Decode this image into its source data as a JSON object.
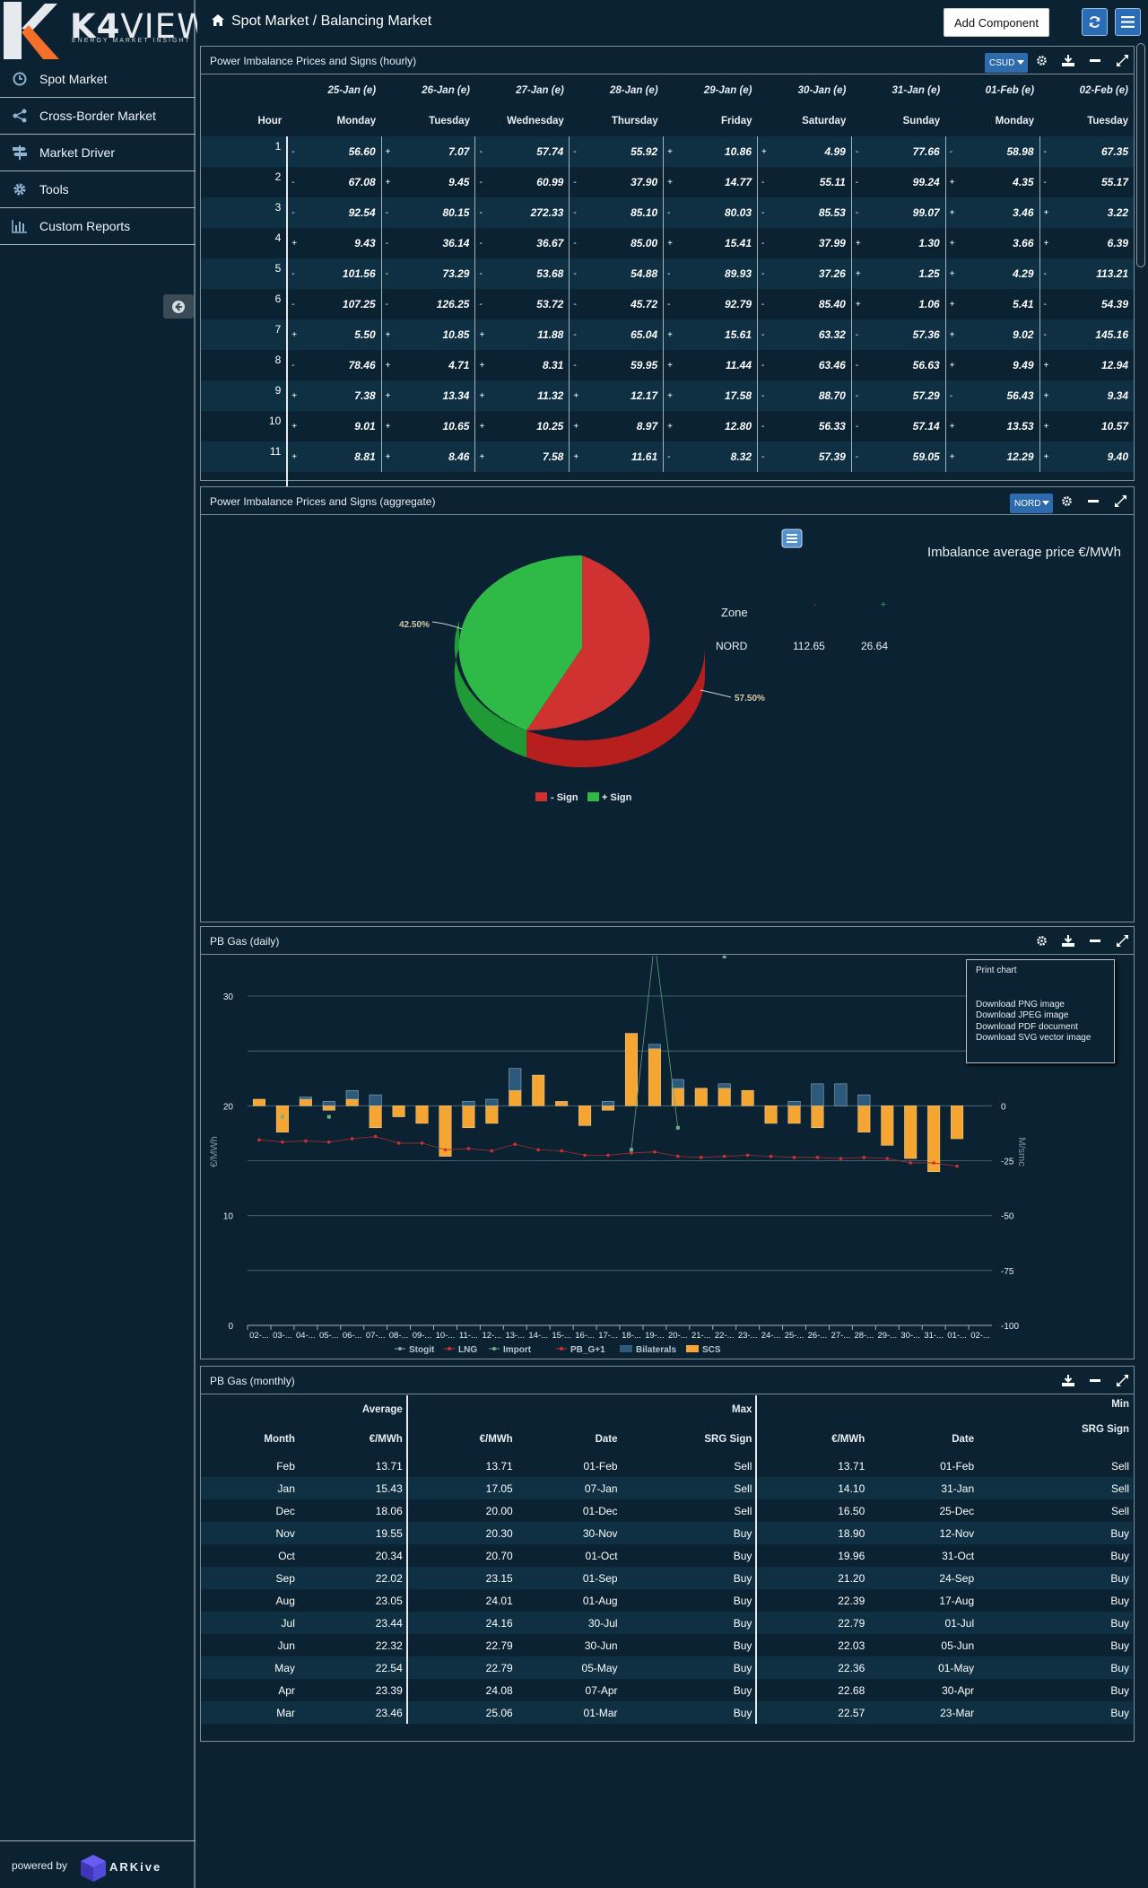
{
  "app": {
    "brand_bold": "K4",
    "brand_light": "VIEW",
    "tagline": "ENERGY MARKET INSIGHT",
    "powered_by": "powered by",
    "vendor": "ARKive",
    "colors": {
      "background": "#0b2233",
      "accent": "#2b6cb7",
      "minus": "#d43030",
      "plus": "#2ebd43",
      "bar_scs": "#f5a531",
      "bar_bilateral": "#2d5a7a"
    }
  },
  "sidebar": {
    "items": [
      {
        "label": "Spot Market",
        "icon": "clock-icon"
      },
      {
        "label": "Cross-Border Market",
        "icon": "share-icon"
      },
      {
        "label": "Market Driver",
        "icon": "signpost-icon"
      },
      {
        "label": "Tools",
        "icon": "gear-icon"
      },
      {
        "label": "Custom Reports",
        "icon": "bar-chart-icon"
      }
    ]
  },
  "header": {
    "breadcrumb": "Spot Market / Balancing Market",
    "add_component": "Add Component"
  },
  "hourly": {
    "title": "Power Imbalance Prices and Signs (hourly)",
    "zone": "CSUD",
    "hour_label": "Hour",
    "dates": [
      "25-Jan (e)",
      "26-Jan (e)",
      "27-Jan (e)",
      "28-Jan (e)",
      "29-Jan (e)",
      "30-Jan (e)",
      "31-Jan (e)",
      "01-Feb (e)",
      "02-Feb (e)"
    ],
    "weekdays": [
      "Monday",
      "Tuesday",
      "Wednesday",
      "Thursday",
      "Friday",
      "Saturday",
      "Sunday",
      "Monday",
      "Tuesday"
    ],
    "rows": [
      {
        "hour": "1",
        "signs": [
          "-",
          "+",
          "-",
          "-",
          "+",
          "+",
          "-",
          "-",
          "-"
        ],
        "values": [
          "56.60",
          "7.07",
          "57.74",
          "55.92",
          "10.86",
          "4.99",
          "77.66",
          "58.98",
          "67.35"
        ]
      },
      {
        "hour": "2",
        "signs": [
          "-",
          "+",
          "-",
          "-",
          "+",
          "-",
          "-",
          "+",
          "-"
        ],
        "values": [
          "67.08",
          "9.45",
          "60.99",
          "37.90",
          "14.77",
          "55.11",
          "99.24",
          "4.35",
          "55.17"
        ]
      },
      {
        "hour": "3",
        "signs": [
          "-",
          "-",
          "-",
          "-",
          "-",
          "-",
          "-",
          "+",
          "+"
        ],
        "values": [
          "92.54",
          "80.15",
          "272.33",
          "85.10",
          "80.03",
          "85.53",
          "99.07",
          "3.46",
          "3.22"
        ]
      },
      {
        "hour": "4",
        "signs": [
          "+",
          "-",
          "-",
          "-",
          "+",
          "-",
          "+",
          "+",
          "+"
        ],
        "values": [
          "9.43",
          "36.14",
          "36.67",
          "85.00",
          "15.41",
          "37.99",
          "1.30",
          "3.66",
          "6.39"
        ]
      },
      {
        "hour": "5",
        "signs": [
          "-",
          "-",
          "-",
          "-",
          "-",
          "-",
          "+",
          "+",
          "-"
        ],
        "values": [
          "101.56",
          "73.29",
          "53.68",
          "54.88",
          "89.93",
          "37.26",
          "1.25",
          "4.29",
          "113.21"
        ]
      },
      {
        "hour": "6",
        "signs": [
          "-",
          "-",
          "-",
          "-",
          "-",
          "-",
          "+",
          "+",
          "-"
        ],
        "values": [
          "107.25",
          "126.25",
          "53.72",
          "45.72",
          "92.79",
          "85.40",
          "1.06",
          "5.41",
          "54.39"
        ]
      },
      {
        "hour": "7",
        "signs": [
          "+",
          "+",
          "+",
          "-",
          "+",
          "-",
          "-",
          "+",
          "-"
        ],
        "values": [
          "5.50",
          "10.85",
          "11.88",
          "65.04",
          "15.61",
          "63.32",
          "57.36",
          "9.02",
          "145.16"
        ]
      },
      {
        "hour": "8",
        "signs": [
          "-",
          "+",
          "+",
          "-",
          "+",
          "-",
          "-",
          "+",
          "+"
        ],
        "values": [
          "78.46",
          "4.71",
          "8.31",
          "59.95",
          "11.44",
          "63.46",
          "56.63",
          "9.49",
          "12.94"
        ]
      },
      {
        "hour": "9",
        "signs": [
          "+",
          "+",
          "+",
          "+",
          "+",
          "-",
          "-",
          "-",
          "+"
        ],
        "values": [
          "7.38",
          "13.34",
          "11.32",
          "12.17",
          "17.58",
          "88.70",
          "57.29",
          "56.43",
          "9.34"
        ]
      },
      {
        "hour": "10",
        "signs": [
          "+",
          "+",
          "+",
          "+",
          "+",
          "-",
          "-",
          "+",
          "+"
        ],
        "values": [
          "9.01",
          "10.65",
          "10.25",
          "8.97",
          "12.80",
          "56.33",
          "57.14",
          "13.53",
          "10.57"
        ]
      },
      {
        "hour": "11",
        "signs": [
          "+",
          "+",
          "+",
          "+",
          "-",
          "-",
          "-",
          "+",
          "+"
        ],
        "values": [
          "8.81",
          "8.46",
          "7.58",
          "11.61",
          "8.32",
          "57.39",
          "59.05",
          "12.29",
          "9.40"
        ]
      }
    ]
  },
  "aggregate": {
    "title": "Power Imbalance Prices and Signs (aggregate)",
    "zone": "NORD",
    "table_title": "Imbalance average price €/MWh",
    "zone_header": "Zone",
    "col_minus": "-",
    "col_plus": "+",
    "row_zone": "NORD",
    "row_minus": "112.65",
    "row_plus": "26.64",
    "label_minus": "57.50%",
    "label_plus": "42.50%",
    "legend_minus": "- Sign",
    "legend_plus": "+ Sign"
  },
  "gas_daily": {
    "title": "PB Gas (daily)",
    "y_left_label": "€/MWh",
    "y_right_label": "M/smc",
    "left_ticks": [
      "30",
      "20",
      "10",
      "0"
    ],
    "right_ticks": [
      "50",
      "25",
      "0",
      "-25",
      "-50",
      "-75",
      "-100"
    ],
    "x_ticks": [
      "02-...",
      "03-...",
      "04-...",
      "05-...",
      "06-...",
      "07-...",
      "08-...",
      "09-...",
      "10-...",
      "11-...",
      "12-...",
      "13-...",
      "14-...",
      "15-...",
      "16-...",
      "17-...",
      "18-...",
      "19-...",
      "20-...",
      "21-...",
      "22-...",
      "23-...",
      "24-...",
      "25-...",
      "26-...",
      "27-...",
      "28-...",
      "29-...",
      "30-...",
      "31-...",
      "01-...",
      "02-..."
    ],
    "legend": [
      "Stogit",
      "LNG",
      "Import",
      "PB_G+1",
      "Bilaterals",
      "SCS"
    ],
    "menu": {
      "print": "Print chart",
      "png": "Download PNG image",
      "jpeg": "Download JPEG image",
      "pdf": "Download PDF document",
      "svg": "Download SVG vector image"
    }
  },
  "chart_data": {
    "type": "bar",
    "categories": [
      "02-...",
      "03-...",
      "04-...",
      "05-...",
      "06-...",
      "07-...",
      "08-...",
      "09-...",
      "10-...",
      "11-...",
      "12-...",
      "13-...",
      "14-...",
      "15-...",
      "16-...",
      "17-...",
      "18-...",
      "19-...",
      "20-...",
      "21-...",
      "22-...",
      "23-...",
      "24-...",
      "25-...",
      "26-...",
      "27-...",
      "28-...",
      "29-...",
      "30-...",
      "31-...",
      "01-...",
      "02-..."
    ],
    "ylim": [
      0,
      30
    ],
    "y2lim": [
      -100,
      50
    ],
    "series": [
      {
        "name": "SCS",
        "axis": "right",
        "values": [
          3,
          -12,
          3,
          -2,
          3,
          -10,
          -5,
          -8,
          -23,
          -10,
          -8,
          7,
          14,
          2,
          -9,
          -2,
          33,
          26,
          8,
          8,
          8,
          7,
          -8,
          -8,
          -10,
          0,
          -12,
          -18,
          -24,
          -30,
          -15,
          0
        ]
      },
      {
        "name": "Bilaterals",
        "axis": "right",
        "values": [
          0,
          -3,
          1,
          2,
          4,
          5,
          0,
          0,
          0,
          2,
          3,
          10,
          0,
          0,
          0,
          2,
          0,
          2,
          4,
          0,
          2,
          0,
          0,
          2,
          10,
          10,
          5,
          0,
          0,
          0,
          0,
          0
        ]
      },
      {
        "name": "PB_G+1",
        "axis": "left",
        "values": [
          16.9,
          16.7,
          16.8,
          16.7,
          17.0,
          17.2,
          16.6,
          16.6,
          16.0,
          16.1,
          15.9,
          16.5,
          16.0,
          15.9,
          15.5,
          15.5,
          15.7,
          15.8,
          15.4,
          15.3,
          15.4,
          15.5,
          15.4,
          15.3,
          15.3,
          15.2,
          15.3,
          15.2,
          14.8,
          14.8,
          14.5
        ]
      },
      {
        "name": "Import",
        "axis": "right",
        "values": [
          null,
          null,
          null,
          null,
          null,
          null,
          null,
          null,
          null,
          null,
          null,
          null,
          null,
          null,
          null,
          null,
          -20,
          75,
          -10,
          null,
          null,
          null,
          null,
          null,
          null,
          null,
          null,
          null,
          null,
          null,
          null,
          null
        ]
      },
      {
        "name": "Stogit",
        "axis": "right",
        "values": [
          null,
          -5,
          null,
          -5,
          null,
          null,
          null,
          null,
          null,
          null,
          null,
          null,
          null,
          null,
          null,
          null,
          null,
          null,
          null,
          null,
          68,
          null,
          null,
          null,
          null,
          null,
          null,
          null,
          null,
          null,
          null,
          null
        ]
      },
      {
        "name": "LNG",
        "axis": "right",
        "values": []
      }
    ]
  },
  "gas_monthly": {
    "title": "PB Gas (monthly)",
    "group_average": "Average",
    "group_max": "Max",
    "group_min": "Min",
    "headers": [
      "Month",
      "€/MWh",
      "€/MWh",
      "Date",
      "SRG Sign",
      "€/MWh",
      "Date",
      "SRG Sign"
    ],
    "rows": [
      [
        "Feb",
        "13.71",
        "13.71",
        "01-Feb",
        "Sell",
        "13.71",
        "01-Feb",
        "Sell"
      ],
      [
        "Jan",
        "15.43",
        "17.05",
        "07-Jan",
        "Sell",
        "14.10",
        "31-Jan",
        "Sell"
      ],
      [
        "Dec",
        "18.06",
        "20.00",
        "01-Dec",
        "Sell",
        "16.50",
        "25-Dec",
        "Sell"
      ],
      [
        "Nov",
        "19.55",
        "20.30",
        "30-Nov",
        "Buy",
        "18.90",
        "12-Nov",
        "Buy"
      ],
      [
        "Oct",
        "20.34",
        "20.70",
        "01-Oct",
        "Buy",
        "19.96",
        "31-Oct",
        "Buy"
      ],
      [
        "Sep",
        "22.02",
        "23.15",
        "01-Sep",
        "Buy",
        "21.20",
        "24-Sep",
        "Buy"
      ],
      [
        "Aug",
        "23.05",
        "24.01",
        "01-Aug",
        "Buy",
        "22.39",
        "17-Aug",
        "Buy"
      ],
      [
        "Jul",
        "23.44",
        "24.16",
        "30-Jul",
        "Buy",
        "22.79",
        "01-Jul",
        "Buy"
      ],
      [
        "Jun",
        "22.32",
        "22.79",
        "30-Jun",
        "Buy",
        "22.03",
        "05-Jun",
        "Buy"
      ],
      [
        "May",
        "22.54",
        "22.79",
        "05-May",
        "Buy",
        "22.36",
        "01-May",
        "Buy"
      ],
      [
        "Apr",
        "23.39",
        "24.08",
        "07-Apr",
        "Buy",
        "22.68",
        "30-Apr",
        "Buy"
      ],
      [
        "Mar",
        "23.46",
        "25.06",
        "01-Mar",
        "Buy",
        "22.57",
        "23-Mar",
        "Buy"
      ]
    ]
  }
}
